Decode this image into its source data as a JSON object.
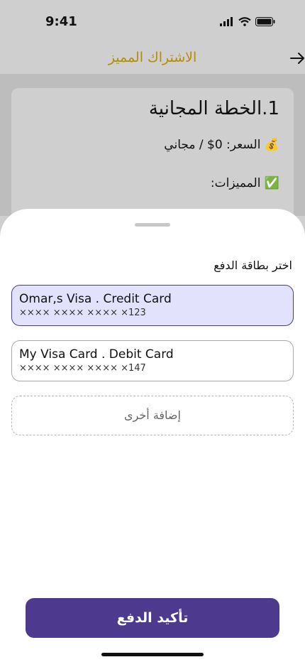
{
  "status_bar": {
    "time": "9:41"
  },
  "header": {
    "title": "الاشتراك المميز"
  },
  "plan": {
    "title": "1.الخطة المجانية",
    "price": "💰 السعر: 0$ / مجاني",
    "features": "✅ المميزات:"
  },
  "sheet": {
    "title": "اختر بطاقة الدفع",
    "cards": [
      {
        "name": "Omar,s Visa . Credit Card",
        "number": "×××× ×××× ×××× ×123",
        "selected": true
      },
      {
        "name": "My Visa Card . Debit Card",
        "number": "×××× ×××× ×××× ×147",
        "selected": false
      }
    ],
    "add_label": "إضافة أخرى",
    "confirm_label": "تأكيد الدفع"
  },
  "colors": {
    "accent": "#4d3a8f",
    "header_title": "#b48d00",
    "selected_bg": "#e2e2fc"
  }
}
